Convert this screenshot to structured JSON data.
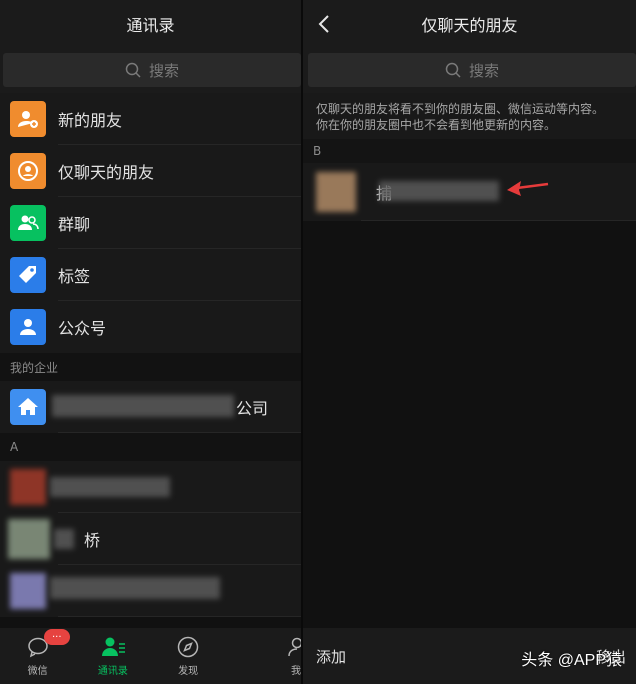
{
  "left": {
    "title": "通讯录",
    "search_placeholder": "搜索",
    "menu_items": [
      {
        "label": "新的朋友",
        "icon": "add-friend-icon",
        "color": "#f08c2e"
      },
      {
        "label": "仅聊天的朋友",
        "icon": "chat-only-icon",
        "color": "#f08c2e"
      },
      {
        "label": "群聊",
        "icon": "group-chat-icon",
        "color": "#07c160"
      },
      {
        "label": "标签",
        "icon": "tag-icon",
        "color": "#2b7de9"
      },
      {
        "label": "公众号",
        "icon": "official-account-icon",
        "color": "#2b7de9"
      }
    ],
    "enterprise_header": "我的企业",
    "enterprise_suffix": "公司",
    "section_a": "A",
    "contact_partial": "桥",
    "tabs": [
      {
        "label": "微信",
        "icon": "chat-bubble-icon",
        "badge": "···"
      },
      {
        "label": "通讯录",
        "icon": "contacts-icon"
      },
      {
        "label": "发现",
        "icon": "compass-icon"
      },
      {
        "label": "我",
        "icon": "person-icon"
      }
    ]
  },
  "right": {
    "title": "仅聊天的朋友",
    "search_placeholder": "搜索",
    "info_line1": "仅聊天的朋友将看不到你的朋友圈、微信运动等内容。",
    "info_line2": "你在你的朋友圈中也不会看到他更新的内容。",
    "section_b": "B",
    "contact_partial": "捕",
    "add_label": "添加",
    "remove_label": "移出"
  },
  "watermark": "头条 @APP猿",
  "colors": {
    "accent_green": "#07c160",
    "arrow_red": "#e63b3b"
  }
}
